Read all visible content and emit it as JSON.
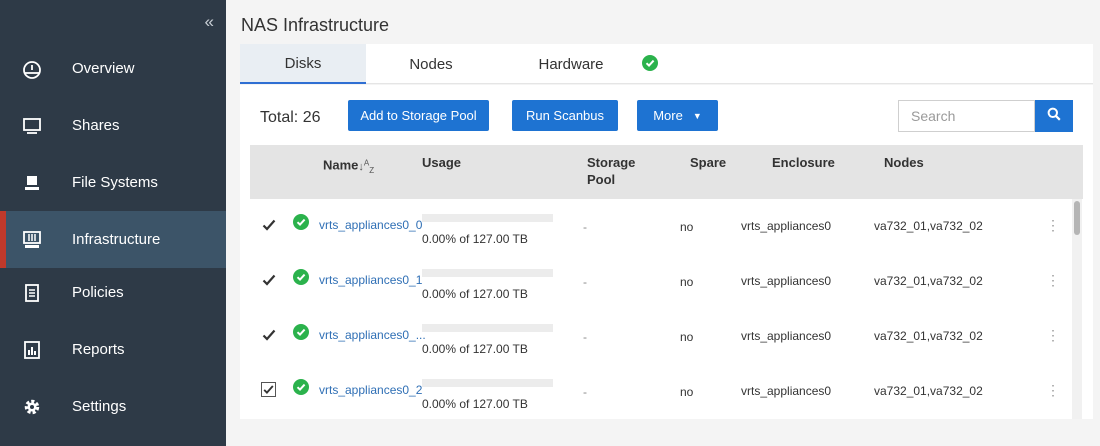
{
  "sidebar": {
    "collapse_icon": "double-chevron-left-icon",
    "collapse_glyph": "«",
    "items": [
      {
        "label": "Overview",
        "icon": "dashboard-gauge-icon",
        "active": false
      },
      {
        "label": "Shares",
        "icon": "monitor-icon",
        "active": false
      },
      {
        "label": "File Systems",
        "icon": "file-systems-icon",
        "active": false
      },
      {
        "label": "Infrastructure",
        "icon": "server-icon",
        "active": true
      },
      {
        "label": "Policies",
        "icon": "document-list-icon",
        "active": false
      },
      {
        "label": "Reports",
        "icon": "report-chart-icon",
        "active": false
      },
      {
        "label": "Settings",
        "icon": "gear-icon",
        "active": false
      }
    ]
  },
  "page": {
    "title": "NAS Infrastructure"
  },
  "tabs": [
    {
      "label": "Disks",
      "active": true
    },
    {
      "label": "Nodes",
      "active": false
    },
    {
      "label": "Hardware",
      "active": false,
      "status_icon": "green-check-circle-icon"
    }
  ],
  "toolbar": {
    "total_label": "Total: 26",
    "add_label": "Add to Storage Pool",
    "scanbus_label": "Run Scanbus",
    "more_label": "More",
    "more_icon": "caret-down-icon",
    "search_placeholder": "Search",
    "search_icon": "search-icon"
  },
  "table": {
    "headers": {
      "name": "Name",
      "sort_icon": "sort-alpha-icon",
      "usage": "Usage",
      "storage_pool_line1": "Storage",
      "storage_pool_line2": "Pool",
      "spare": "Spare",
      "enclosure": "Enclosure",
      "nodes": "Nodes"
    },
    "rows": [
      {
        "checked": true,
        "status": "healthy",
        "name": "vrts_appliances0_0",
        "usage_fraction": 0.0,
        "usage": "0.00% of 127.00 TB",
        "pool": "-",
        "spare": "no",
        "enclosure": "vrts_appliances0",
        "nodes": "va732_01,va732_02"
      },
      {
        "checked": true,
        "status": "healthy",
        "name": "vrts_appliances0_1",
        "usage_fraction": 0.0,
        "usage": "0.00% of 127.00 TB",
        "pool": "-",
        "spare": "no",
        "enclosure": "vrts_appliances0",
        "nodes": "va732_01,va732_02"
      },
      {
        "checked": true,
        "status": "healthy",
        "name": "vrts_appliances0_...",
        "usage_fraction": 0.0,
        "usage": "0.00% of 127.00 TB",
        "pool": "-",
        "spare": "no",
        "enclosure": "vrts_appliances0",
        "nodes": "va732_01,va732_02"
      },
      {
        "checked": true,
        "status": "healthy",
        "name": "vrts_appliances0_2",
        "usage_fraction": 0.0,
        "usage": "0.00% of 127.00 TB",
        "pool": "-",
        "spare": "no",
        "enclosure": "vrts_appliances0",
        "nodes": "va732_01,va732_02"
      }
    ]
  },
  "colors": {
    "sidebar_bg": "#2e3a47",
    "sidebar_active": "#3c5468",
    "active_marker": "#c0392b",
    "primary": "#1e73d2",
    "success": "#2bb24c",
    "link": "#2f6fb5"
  }
}
